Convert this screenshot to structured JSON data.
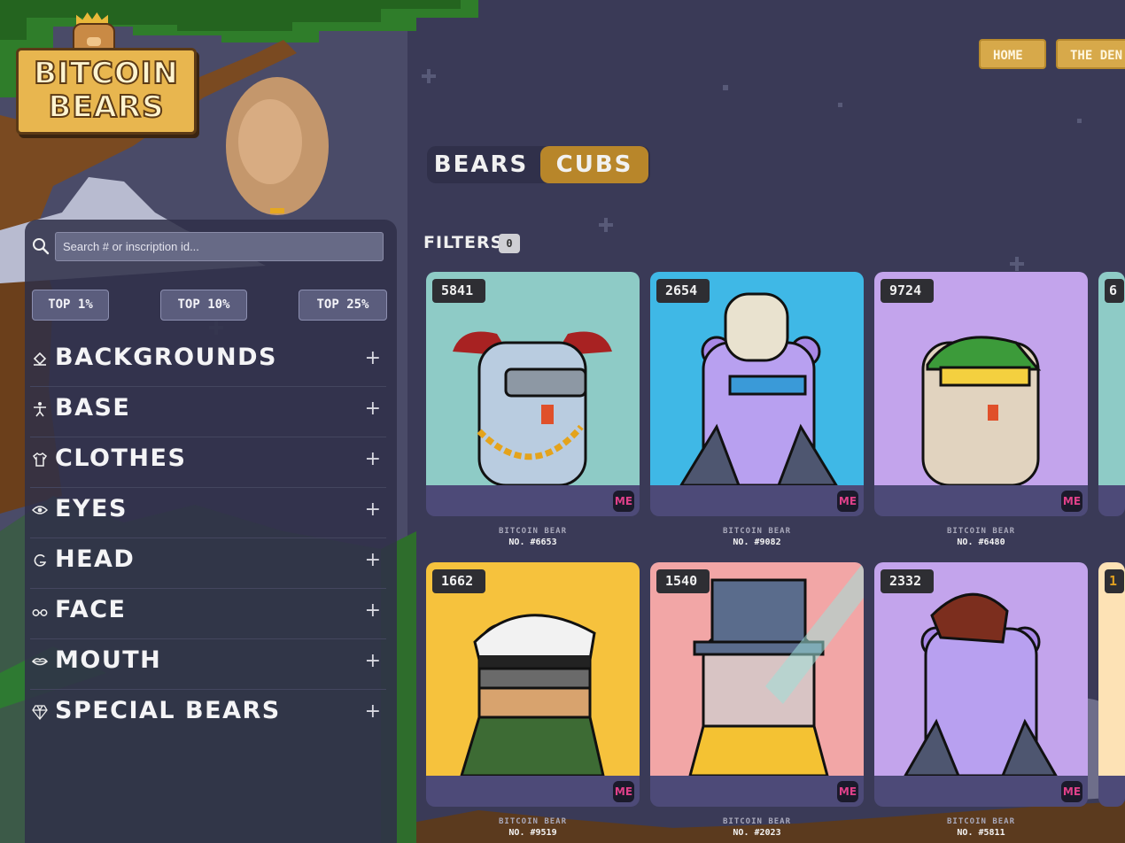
{
  "app": {
    "logo_line1": "BITCOIN",
    "logo_line2": "BEARS"
  },
  "nav": {
    "items": [
      "HOME",
      "THE DEN"
    ]
  },
  "collection_toggle": {
    "options": [
      "BEARS",
      "CUBS"
    ],
    "selected": "CUBS"
  },
  "filters": {
    "title": "FILTERS",
    "count": "0"
  },
  "sidebar": {
    "search_placeholder": "Search # or inscription id...",
    "tiers": [
      "TOP 1%",
      "TOP 10%",
      "TOP 25%"
    ],
    "categories": [
      {
        "label": "BACKGROUNDS",
        "icon": "paint-bucket-icon"
      },
      {
        "label": "BASE",
        "icon": "person-icon"
      },
      {
        "label": "CLOTHES",
        "icon": "shirt-icon"
      },
      {
        "label": "EYES",
        "icon": "eye-icon"
      },
      {
        "label": "HEAD",
        "icon": "head-icon"
      },
      {
        "label": "FACE",
        "icon": "glasses-icon"
      },
      {
        "label": "MOUTH",
        "icon": "lips-icon"
      },
      {
        "label": "SPECIAL BEARS",
        "icon": "diamond-icon"
      }
    ],
    "expand_symbol": "+"
  },
  "cards": [
    {
      "rank": "5841",
      "label": "BITCOIN BEAR",
      "number": "NO. #6653",
      "bg": "#8ecbc6"
    },
    {
      "rank": "2654",
      "label": "BITCOIN BEAR",
      "number": "NO. #9082",
      "bg": "#3fb8e6"
    },
    {
      "rank": "9724",
      "label": "BITCOIN BEAR",
      "number": "NO. #6480",
      "bg": "#c3a4ec"
    },
    {
      "rank": "6",
      "label": "",
      "number": "",
      "bg": "#8ecbc6"
    },
    {
      "rank": "1662",
      "label": "BITCOIN BEAR",
      "number": "NO. #9519",
      "bg": "#f6c23d"
    },
    {
      "rank": "1540",
      "label": "BITCOIN BEAR",
      "number": "NO. #2023",
      "bg": "#f2a6a6"
    },
    {
      "rank": "2332",
      "label": "BITCOIN BEAR",
      "number": "NO. #5811",
      "bg": "#c3a4ec"
    },
    {
      "rank": "1",
      "label": "",
      "number": "",
      "bg": "#fde2b5"
    }
  ],
  "marketplace_badge": "ME",
  "colors": {
    "accent_gold": "#b8862a",
    "page_bg": "#3a3a57",
    "sidebar_bg": "#303048",
    "card_footer": "#4d4a78"
  }
}
